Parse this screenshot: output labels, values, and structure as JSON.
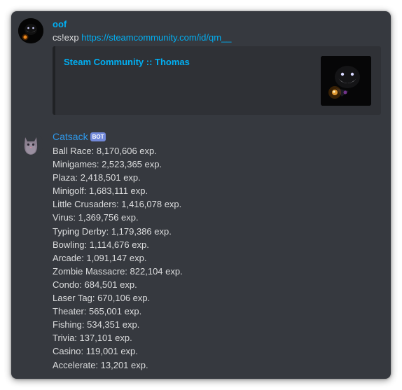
{
  "messages": [
    {
      "author": "oof",
      "avatar_icon": "dark-character-avatar-icon",
      "text_prefix": "cs!exp ",
      "link": "https://steamcommunity.com/id/qm__",
      "embed": {
        "title": "Steam Community :: Thomas",
        "thumbnail_icon": "dark-character-thumbnail-icon"
      }
    },
    {
      "author": "Catsack",
      "bot_tag": "BOT",
      "avatar_icon": "cat-avatar-icon",
      "lines": [
        "Ball Race: 8,170,606 exp.",
        "Minigames: 2,523,365 exp.",
        "Plaza: 2,418,501 exp.",
        "Minigolf: 1,683,111 exp.",
        "Little Crusaders: 1,416,078 exp.",
        "Virus: 1,369,756 exp.",
        "Typing Derby: 1,179,386 exp.",
        "Bowling: 1,114,676 exp.",
        "Arcade: 1,091,147 exp.",
        "Zombie Massacre: 822,104 exp.",
        "Condo: 684,501 exp.",
        "Laser Tag: 670,106 exp.",
        "Theater: 565,001 exp.",
        "Fishing: 534,351 exp.",
        "Trivia: 137,101 exp.",
        "Casino: 119,001 exp.",
        "Accelerate: 13,201 exp."
      ]
    }
  ],
  "colors": {
    "background": "#36393f",
    "embed_background": "#2f3136",
    "link": "#00b0f4",
    "text": "#dcddde",
    "bot_tag": "#7289da",
    "catsack_name": "#2f98e9"
  }
}
